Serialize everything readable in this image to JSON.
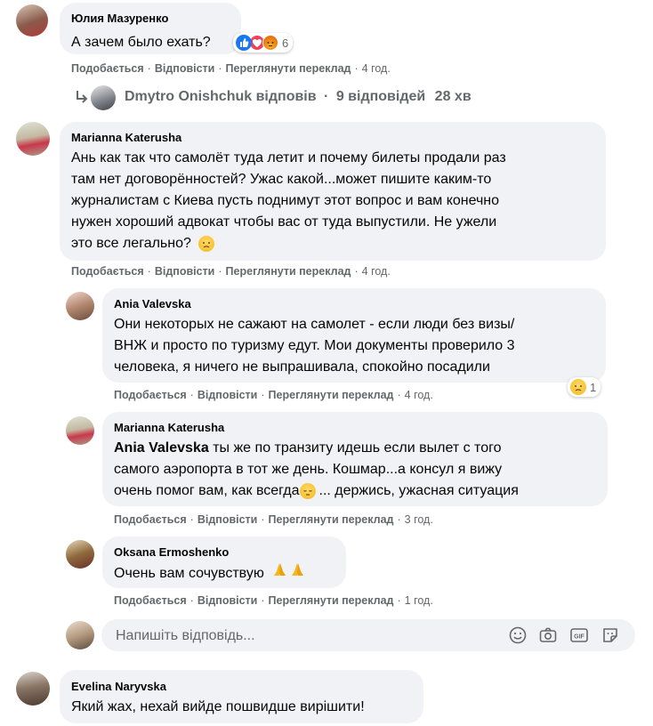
{
  "comments": [
    {
      "author": "Юлия Мазуренко",
      "lines": [
        "А зачем было ехать?"
      ],
      "reaction_count": "6",
      "like": "Подобається",
      "reply": "Відповісти",
      "translate": "Переглянути переклад",
      "time": "4 год."
    },
    {
      "author": "Marianna Katerusha",
      "lines": [
        "Ань как так что самолёт туда летит и почему билеты продали раз",
        "там нет договорённостей? Ужас какой...может пишите каким-то",
        "журналистам с Киева пусть поднимут этот вопрос и вам конечно",
        "нужен хороший адвокат чтобы вас от туда выпустили. Не ужели",
        "это все легально?"
      ],
      "like": "Подобається",
      "reply": "Відповісти",
      "translate": "Переглянути переклад",
      "time": "4 год."
    }
  ],
  "replies_summary": {
    "author": "Dmytro Onishchuk",
    "text": "відповів",
    "count": "9 відповідей",
    "time": "28 хв"
  },
  "replies": [
    {
      "author": "Ania Valevska",
      "lines": [
        "Они некоторых не сажают на самолет - если люди без визы/",
        "ВНЖ и просто по туризму едут. Мои документы проверило 3",
        "человека, я ничего не выпрашивала, спокойно посадили"
      ],
      "reaction_count": "1",
      "like": "Подобається",
      "reply": "Відповісти",
      "translate": "Переглянути переклад",
      "time": "4 год."
    },
    {
      "author": "Marianna Katerusha",
      "mention": "Ania Valevska",
      "lines": [
        "ты же по транзиту идешь если вылет с того",
        "самого аэропорта в тот же день. Кошмар...а консул я вижу",
        "очень помог вам, как всегда",
        "... держись, ужасная ситуация"
      ],
      "like": "Подобається",
      "reply": "Відповісти",
      "translate": "Переглянути переклад",
      "time": "3 год."
    },
    {
      "author": "Oksana Ermoshenko",
      "lines": [
        "Очень вам сочувствую"
      ],
      "like": "Подобається",
      "reply": "Відповісти",
      "translate": "Переглянути переклад",
      "time": "1 год."
    }
  ],
  "reply_input": {
    "placeholder": "Напишіть відповідь..."
  },
  "last_comment": {
    "author": "Evelina Naryvska",
    "lines": [
      "Який жах, нехай вийде пошвидше вирішити!"
    ]
  },
  "icons": {
    "reply_arrow": "reply-arrow-icon",
    "emoji": "emoji-icon",
    "camera": "camera-icon",
    "gif": "gif-icon",
    "sticker": "sticker-icon"
  },
  "colors": {
    "bubble": "#f0f2f5",
    "meta": "#65676b",
    "text": "#050505",
    "like_blue": "#1877f2",
    "love_red": "#f33e58",
    "angry_orange": "#e9710f"
  }
}
